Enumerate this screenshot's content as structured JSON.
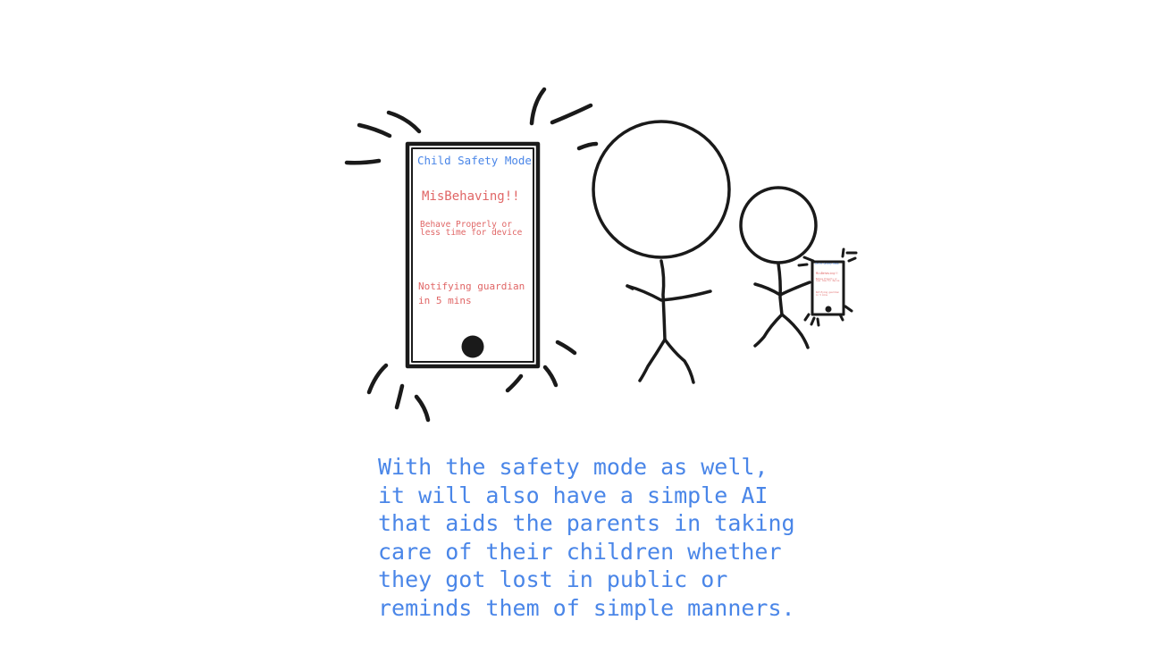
{
  "colors": {
    "ink": "#1a1a1a",
    "blue_text": "#4a86e8",
    "red_text": "#e06666",
    "background": "#ffffff"
  },
  "phone": {
    "title": "Child Safety Mode",
    "alert": "MisBehaving!!",
    "warning": "Behave Properly or\nless time for device",
    "notify": "Notifying guardian\nin 5 mins"
  },
  "mini_phone": {
    "title": "Child Safety Mode",
    "alert": "MisBehaving!!",
    "warning": "Behave Properly or\nless time for device",
    "notify": "Notifying guardian\nin 5 mins"
  },
  "caption": "With the safety mode as well,\nit will also have a simple AI\nthat aids the parents in taking\ncare of their children whether\nthey got lost in public or\nreminds them of simple manners."
}
